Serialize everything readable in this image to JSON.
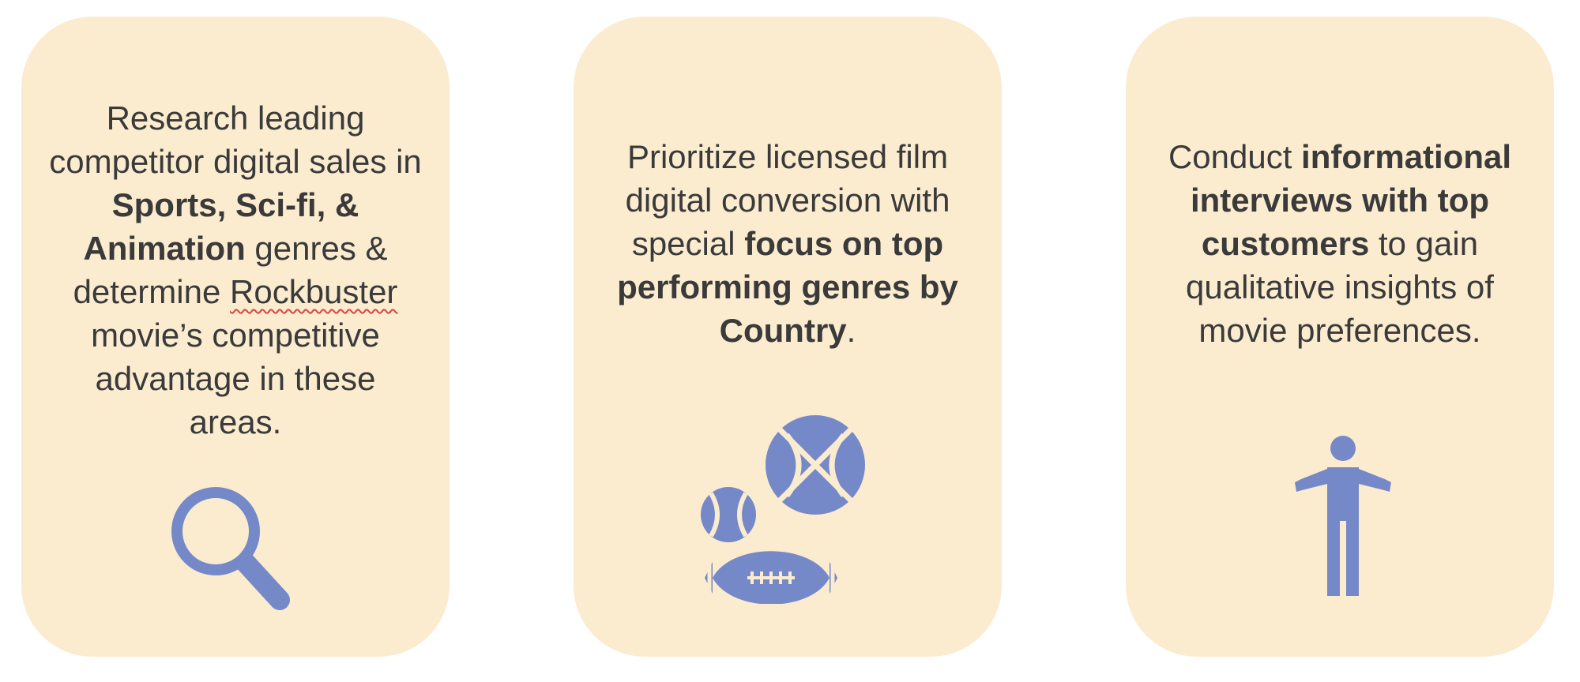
{
  "cards": [
    {
      "segments": [
        {
          "text": "Research leading competitor digital sales in "
        },
        {
          "text": "Sports, Sci-fi, & Animation",
          "bold": true
        },
        {
          "text": " genres & determine "
        },
        {
          "text": "Rockbuster",
          "spellcheck": true
        },
        {
          "text": " movie’s competitive advantage in these areas."
        }
      ],
      "icon": "search-icon"
    },
    {
      "segments": [
        {
          "text": "Prioritize licensed film digital conversion with special "
        },
        {
          "text": "focus on top performing genres by Country",
          "bold": true
        },
        {
          "text": "."
        }
      ],
      "icon": "sports-balls-icon"
    },
    {
      "segments": [
        {
          "text": "Conduct "
        },
        {
          "text": "informational interviews with top customers",
          "bold": true
        },
        {
          "text": " to gain qualitative insights of movie preferences."
        }
      ],
      "icon": "person-shrug-icon"
    }
  ],
  "colors": {
    "card_background": "#fbecd0",
    "icon": "#7589c8",
    "text": "#3a3a3a"
  }
}
